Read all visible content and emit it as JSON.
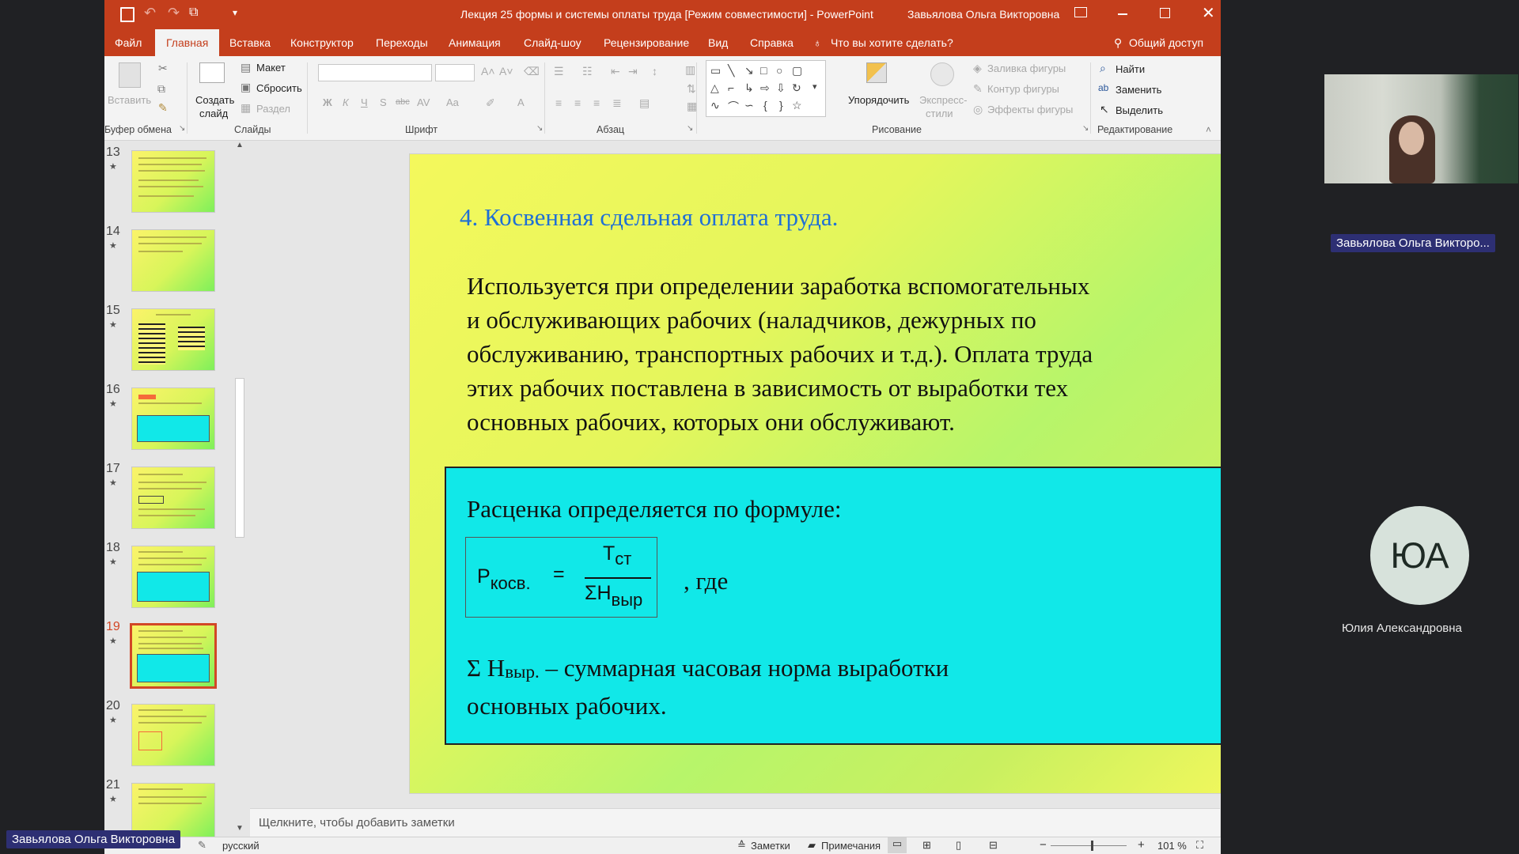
{
  "window": {
    "title": "Лекция 25 формы и системы оплаты труда  [Режим совместимости]  -  PowerPoint",
    "user": "Завьялова Ольга Викторовна"
  },
  "tabs": [
    "Файл",
    "Главная",
    "Вставка",
    "Конструктор",
    "Переходы",
    "Анимация",
    "Слайд-шоу",
    "Рецензирование",
    "Вид",
    "Справка"
  ],
  "tell_me": "Что вы хотите сделать?",
  "share": "Общий доступ",
  "ribbon": {
    "clipboard": {
      "paste": "Вставить",
      "label": "Буфер обмена"
    },
    "slides": {
      "new_slide_1": "Создать",
      "new_slide_2": "слайд",
      "layout": "Макет",
      "reset": "Сбросить",
      "section": "Раздел",
      "label": "Слайды"
    },
    "font": {
      "label": "Шрифт",
      "bold": "Ж",
      "italic": "К",
      "underline": "Ч",
      "strike": "S",
      "abc": "abc",
      "av": "AV",
      "aa": "Aa",
      "a": "A"
    },
    "paragraph": {
      "label": "Абзац"
    },
    "drawing": {
      "arrange": "Упорядочить",
      "quick_styles_1": "Экспресс-",
      "quick_styles_2": "стили",
      "fill": "Заливка фигуры",
      "outline": "Контур фигуры",
      "effects": "Эффекты фигуры",
      "label": "Рисование"
    },
    "editing": {
      "find": "Найти",
      "replace": "Заменить",
      "select": "Выделить",
      "label": "Редактирование"
    }
  },
  "thumbnails": [
    {
      "num": "13",
      "star": "★"
    },
    {
      "num": "14",
      "star": "★"
    },
    {
      "num": "15",
      "star": "★"
    },
    {
      "num": "16",
      "star": "★"
    },
    {
      "num": "17",
      "star": "★"
    },
    {
      "num": "18",
      "star": "★"
    },
    {
      "num": "19",
      "star": "★",
      "selected": true
    },
    {
      "num": "20",
      "star": "★"
    },
    {
      "num": "21",
      "star": "★"
    }
  ],
  "slide": {
    "heading": "4. Косвенная сдельная оплата труда.",
    "body_lines": [
      "Используется при определении заработка вспомогательных",
      "и обслуживающих рабочих (наладчиков, дежурных по",
      "обслуживанию, транспортных рабочих и т.д.). Оплата труда",
      "этих рабочих поставлена в зависимость от выработки тех",
      "основных рабочих, которых они обслуживают."
    ],
    "box_heading": "Расценка определяется по формуле:",
    "formula": {
      "lhs": "Р",
      "lhs_sub": "косв.",
      "eq": "=",
      "num": "Т",
      "num_sub": "ст",
      "den": "ΣН",
      "den_sub": "выр",
      "where": ", где"
    },
    "def_1a": "Σ Н",
    "def_1_sub": "выр.",
    "def_1b": " – суммарная часовая норма выработки",
    "def_2": "основных рабочих."
  },
  "notes_placeholder": "Щелкните, чтобы добавить заметки",
  "status": {
    "language": "русский",
    "notes": "Заметки",
    "comments": "Примечания",
    "zoom": "101 %"
  },
  "participants": {
    "speaker_name": "Завьялова Ольга Викторо...",
    "speaker_full": "Завьялова Ольга Викторовна",
    "avatar_initials": "ЮА",
    "avatar_name": "Юлия Александровна"
  },
  "colors": {
    "ppt_red": "#c43e1c",
    "heading_blue": "#1f6fd6",
    "box_cyan": "#11e8e8",
    "thumb_selected": "#d24726",
    "avatar_bg": "#d7e2db",
    "name_badge": "#2d2f73"
  }
}
